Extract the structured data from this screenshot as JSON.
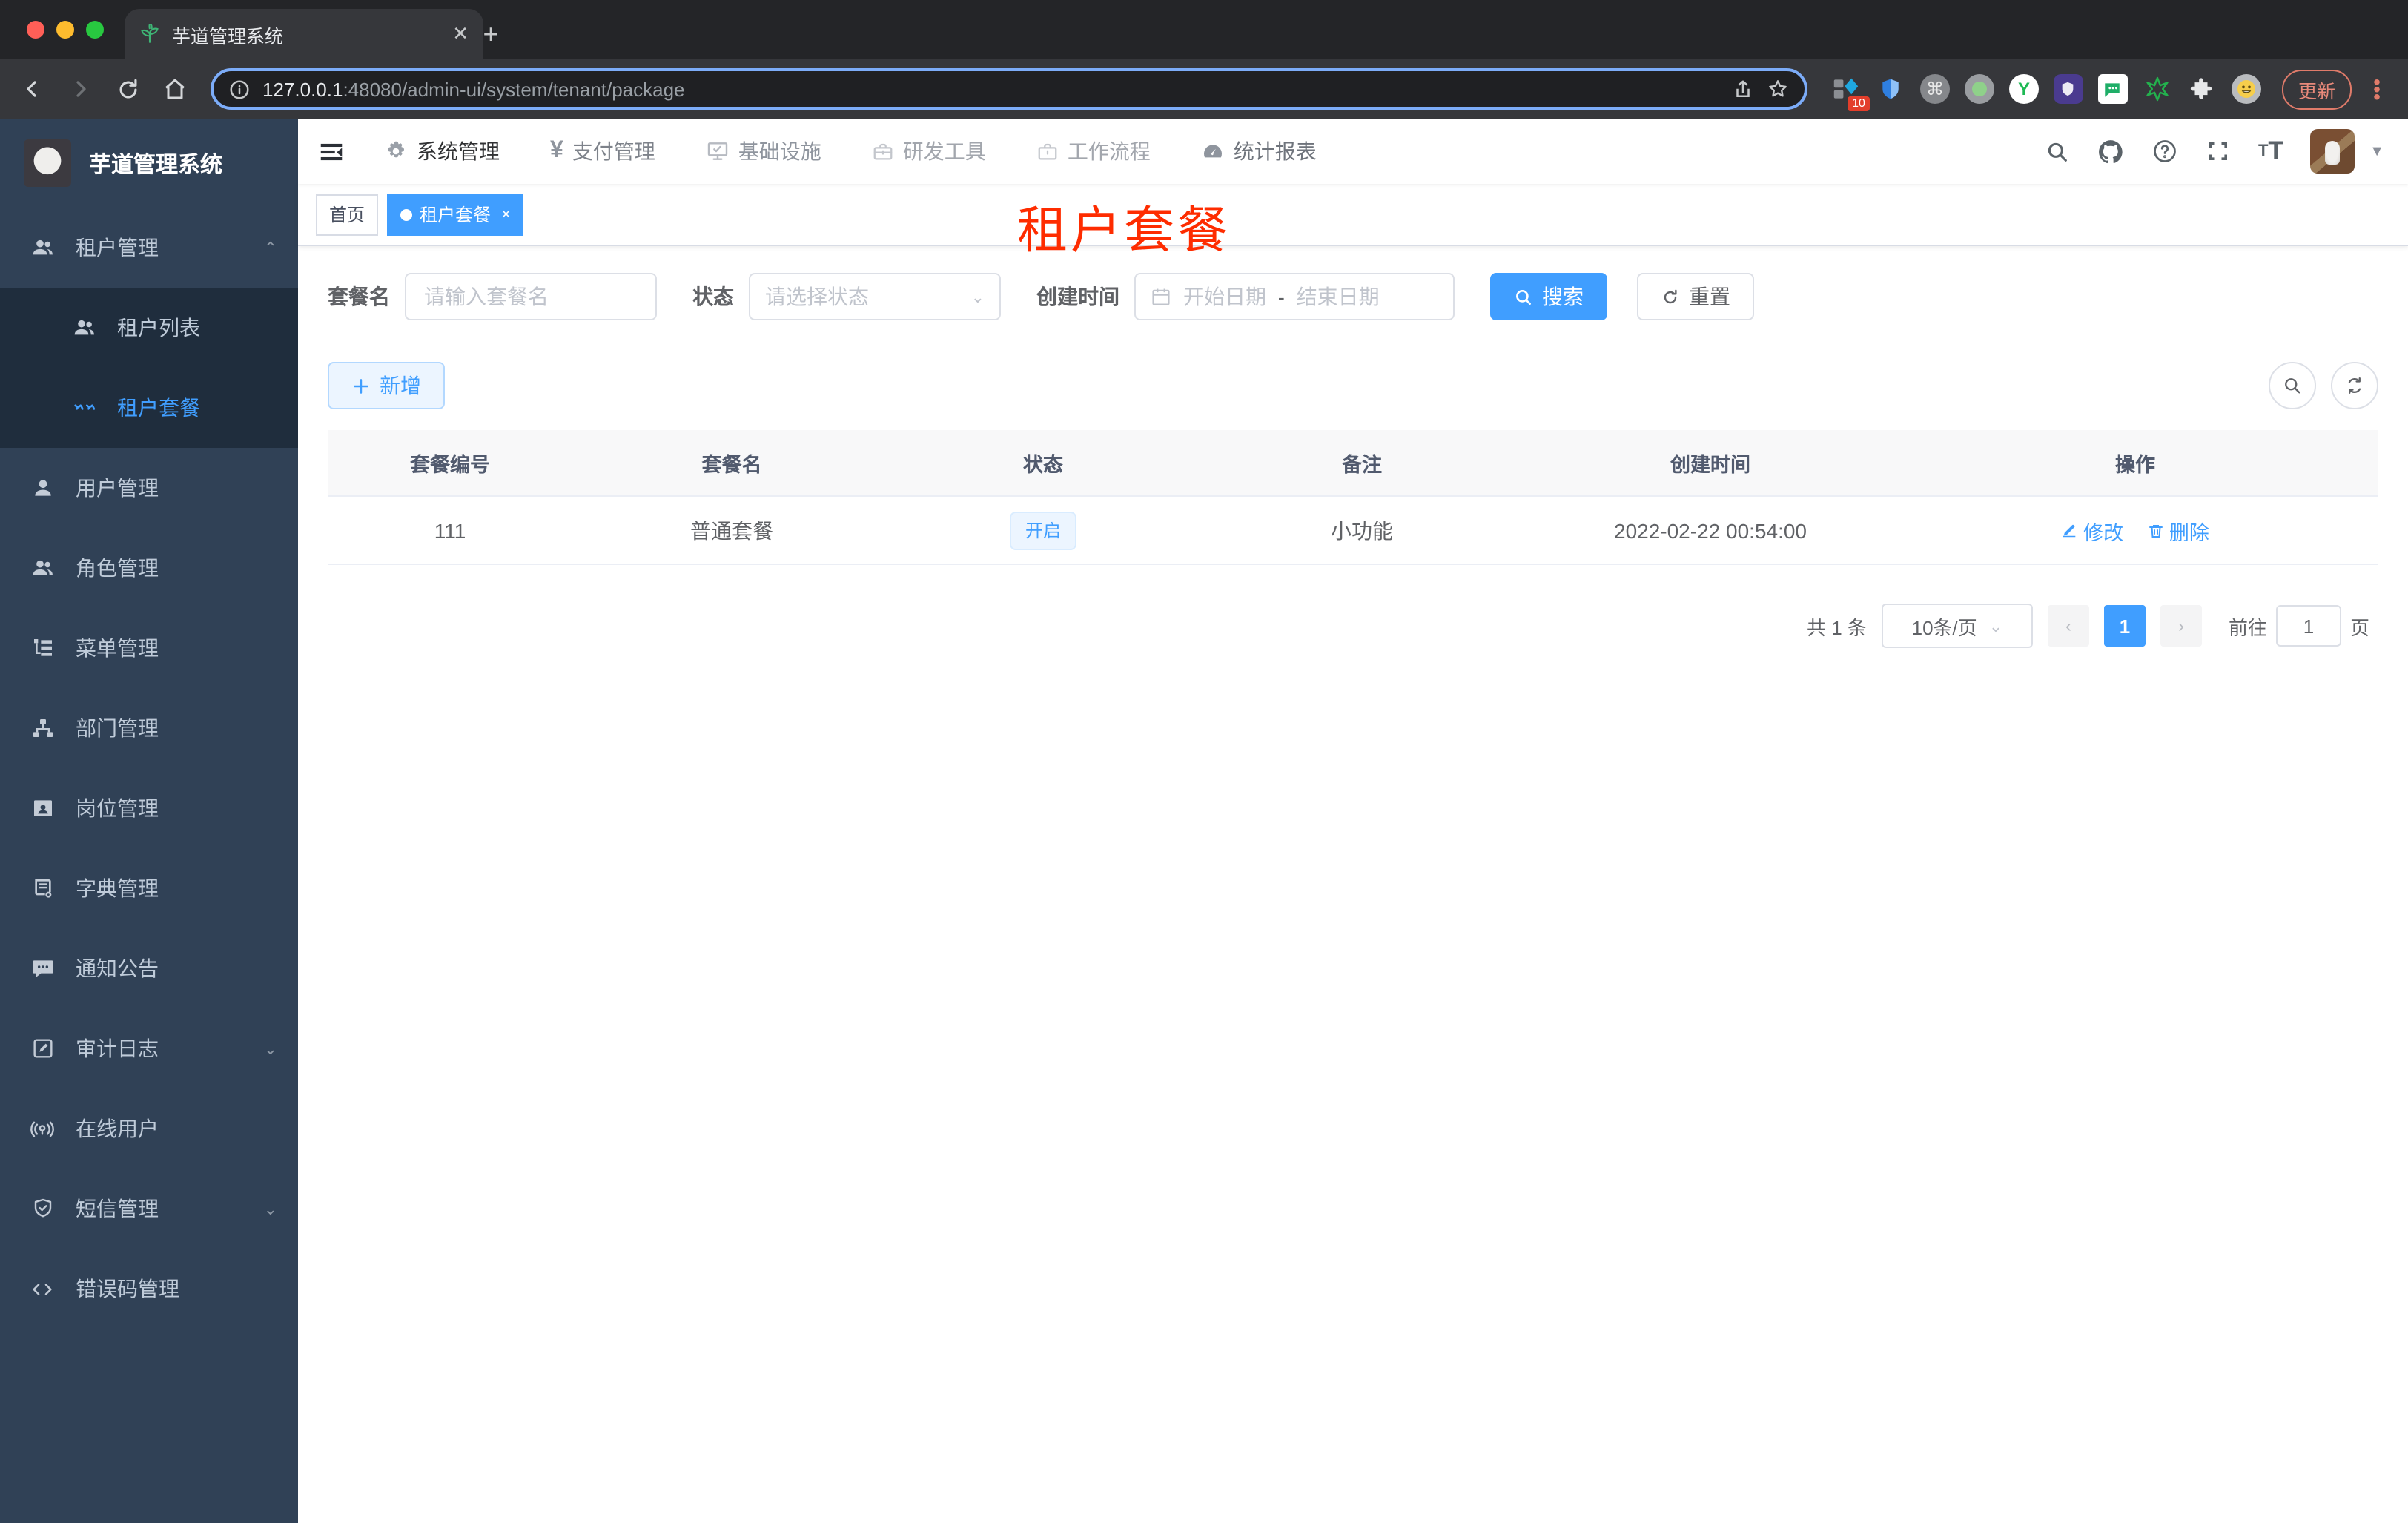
{
  "browser": {
    "tab_title": "芋道管理系统",
    "new_tab": "+",
    "close_tab": "✕",
    "url_host": "127.0.0.1",
    "url_path": ":48080/admin-ui/system/tenant/package",
    "extension_badge": "10",
    "ext_y_label": "Y",
    "ext_cmd_label": "⌘",
    "update_label": "更新"
  },
  "sidebar": {
    "title": "芋道管理系统",
    "items": [
      {
        "label": "租户管理"
      },
      {
        "label": "租户列表"
      },
      {
        "label": "租户套餐"
      },
      {
        "label": "用户管理"
      },
      {
        "label": "角色管理"
      },
      {
        "label": "菜单管理"
      },
      {
        "label": "部门管理"
      },
      {
        "label": "岗位管理"
      },
      {
        "label": "字典管理"
      },
      {
        "label": "通知公告"
      },
      {
        "label": "审计日志"
      },
      {
        "label": "在线用户"
      },
      {
        "label": "短信管理"
      },
      {
        "label": "错误码管理"
      }
    ]
  },
  "topnav": {
    "items": [
      {
        "label": "系统管理"
      },
      {
        "label": "支付管理"
      },
      {
        "label": "基础设施"
      },
      {
        "label": "研发工具"
      },
      {
        "label": "工作流程"
      },
      {
        "label": "统计报表"
      }
    ]
  },
  "tags": {
    "home": "首页",
    "current": "租户套餐",
    "close": "×"
  },
  "annotation": {
    "text": "租户套餐"
  },
  "filters": {
    "name_label": "套餐名",
    "name_placeholder": "请输入套餐名",
    "status_label": "状态",
    "status_placeholder": "请选择状态",
    "date_label": "创建时间",
    "date_start": "开始日期",
    "date_sep": "-",
    "date_end": "结束日期",
    "search_label": "搜索",
    "reset_label": "重置"
  },
  "toolbar": {
    "add_label": "新增"
  },
  "table": {
    "headers": [
      "套餐编号",
      "套餐名",
      "状态",
      "备注",
      "创建时间",
      "操作"
    ],
    "rows": [
      {
        "id": "111",
        "name": "普通套餐",
        "status": "开启",
        "remark": "小功能",
        "created": "2022-02-22 00:54:00",
        "edit": "修改",
        "delete": "删除"
      }
    ]
  },
  "pagination": {
    "total": "共 1 条",
    "page_size": "10条/页",
    "prev": "‹",
    "current": "1",
    "next": "›",
    "goto": "前往",
    "page_value": "1",
    "unit": "页"
  },
  "colors": {
    "primary": "#409eff",
    "annotation_red": "#fe2c00",
    "sidebar_bg": "#304156",
    "submenu_bg": "#1f2d3d"
  }
}
